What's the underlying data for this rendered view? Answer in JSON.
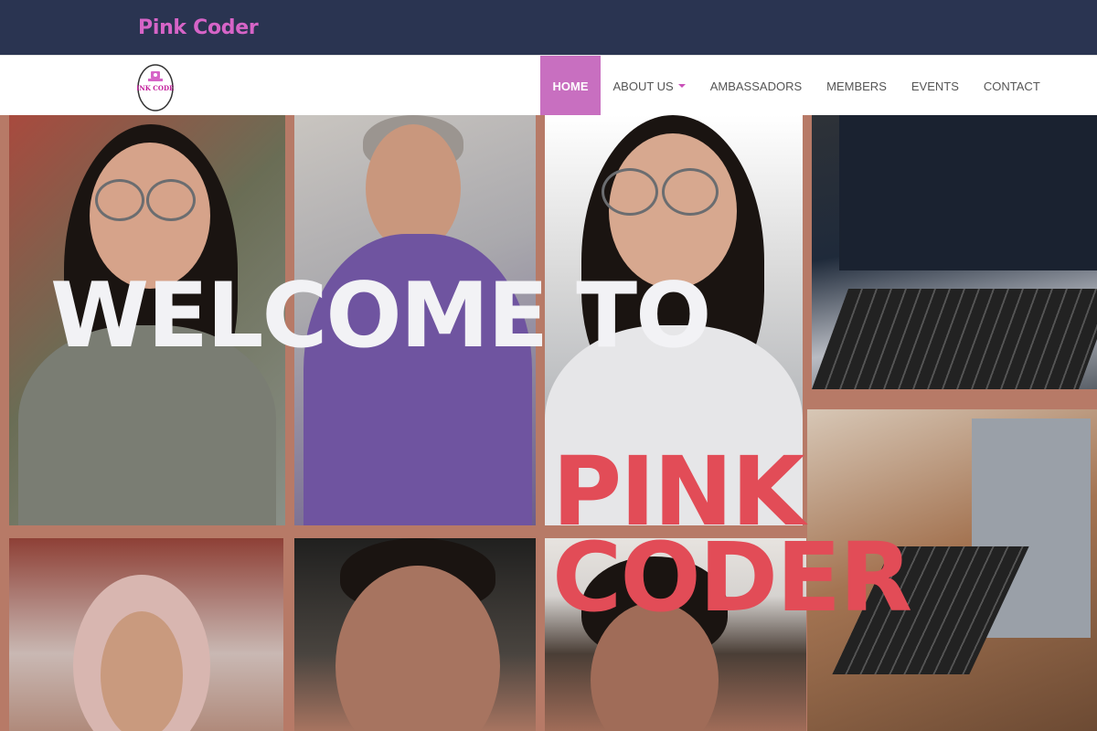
{
  "topbar": {
    "brand": "Pink Coder"
  },
  "navbar": {
    "logo_text": "PINK CODER",
    "items": [
      {
        "label": "HOME",
        "active": true
      },
      {
        "label": "ABOUT US",
        "dropdown": true
      },
      {
        "label": "AMBASSADORS"
      },
      {
        "label": "MEMBERS"
      },
      {
        "label": "EVENTS"
      },
      {
        "label": "CONTACT"
      }
    ]
  },
  "hero": {
    "headline": "WELCOME TO",
    "brand_line1": "PINK",
    "brand_line2": "CODER"
  },
  "colors": {
    "topbar": "#2a3451",
    "brand": "#d664c7",
    "nav_active": "#c86fc0",
    "caret": "#c94fb8",
    "collage_border": "#b77a67",
    "pink_text": "#e24c57",
    "welcome_text": "#f2f2f5"
  }
}
